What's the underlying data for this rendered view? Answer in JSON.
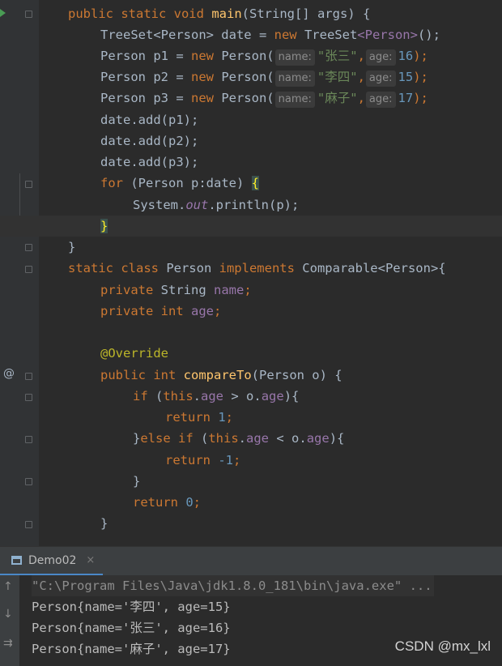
{
  "code": {
    "main_sig": {
      "kw": "public static void",
      "name": "main",
      "params": "(String[] args) {"
    },
    "treeset": {
      "type": "TreeSet<Person> date = ",
      "new_kw": "new",
      "type2": " TreeSet",
      "generic": "<Person>",
      "end": "();"
    },
    "persons": [
      {
        "decl": "Person p1 = ",
        "new_kw": "new",
        "ctor": " Person(",
        "hint_name": "name:",
        "name_val": "\"张三\"",
        "comma": ",",
        "hint_age": "age:",
        "age_val": "16",
        "end": ");"
      },
      {
        "decl": "Person p2 = ",
        "new_kw": "new",
        "ctor": " Person(",
        "hint_name": "name:",
        "name_val": "\"李四\"",
        "comma": ",",
        "hint_age": "age:",
        "age_val": "15",
        "end": ");"
      },
      {
        "decl": "Person p3 = ",
        "new_kw": "new",
        "ctor": " Person(",
        "hint_name": "name:",
        "name_val": "\"麻子\"",
        "comma": ",",
        "hint_age": "age:",
        "age_val": "17",
        "end": ");"
      }
    ],
    "adds": [
      "date.add(p1);",
      "date.add(p2);",
      "date.add(p3);"
    ],
    "for_loop": {
      "kw": "for",
      "head": " (Person p:date) ",
      "brace": "{"
    },
    "println": {
      "pre": "System.",
      "field": "out",
      "post": ".println(p);"
    },
    "close_brace_hl": "}",
    "close_brace": "}",
    "class_decl": {
      "kw": "static class",
      "name": " Person ",
      "kw2": "implements",
      "rest": " Comparable<Person>{"
    },
    "fields": [
      {
        "kw": "private",
        "type": " String ",
        "name": "name",
        "end": ";"
      },
      {
        "kw": "private",
        "type": " int ",
        "name": "age",
        "end": ";"
      }
    ],
    "annotation": "@Override",
    "compare_sig": {
      "kw": "public int",
      "name": " compareTo",
      "params": "(Person o) {"
    },
    "if_line": {
      "kw": "if",
      "a": " (",
      "this_kw": "this",
      "dot": ".",
      "f1": "age",
      "mid": " > o.",
      "f2": "age",
      "end": "){"
    },
    "return1": {
      "kw": "return",
      "val": " 1",
      "end": ";"
    },
    "elseif_line": {
      "pre": "}",
      "kw": "else if",
      "a": " (",
      "this_kw": "this",
      "dot": ".",
      "f1": "age",
      "mid": " < o.",
      "f2": "age",
      "end": "){"
    },
    "return_neg": {
      "kw": "return",
      "val": " -1",
      "end": ";"
    },
    "close_if": "}",
    "return0": {
      "kw": "return",
      "val": " 0",
      "end": ";"
    },
    "close_method": "}"
  },
  "run_panel": {
    "tab_label": "Demo02",
    "tab_close": "×",
    "command": "\"C:\\Program Files\\Java\\jdk1.8.0_181\\bin\\java.exe\" ...",
    "output": [
      "Person{name='李四', age=15}",
      "Person{name='张三', age=16}",
      "Person{name='麻子', age=17}"
    ]
  },
  "gutter": {
    "override_icon": "@",
    "up_icon": "↑",
    "down_icon": "↓",
    "wrap_icon": "⇉"
  },
  "watermark": "CSDN @mx_lxl",
  "colors": {
    "keyword": "#cc7832",
    "method": "#ffc66d",
    "string": "#6a8759",
    "number": "#6897bb",
    "field": "#9876aa",
    "annotation": "#bbb529",
    "text": "#a9b7c6",
    "background": "#2b2b2b"
  }
}
